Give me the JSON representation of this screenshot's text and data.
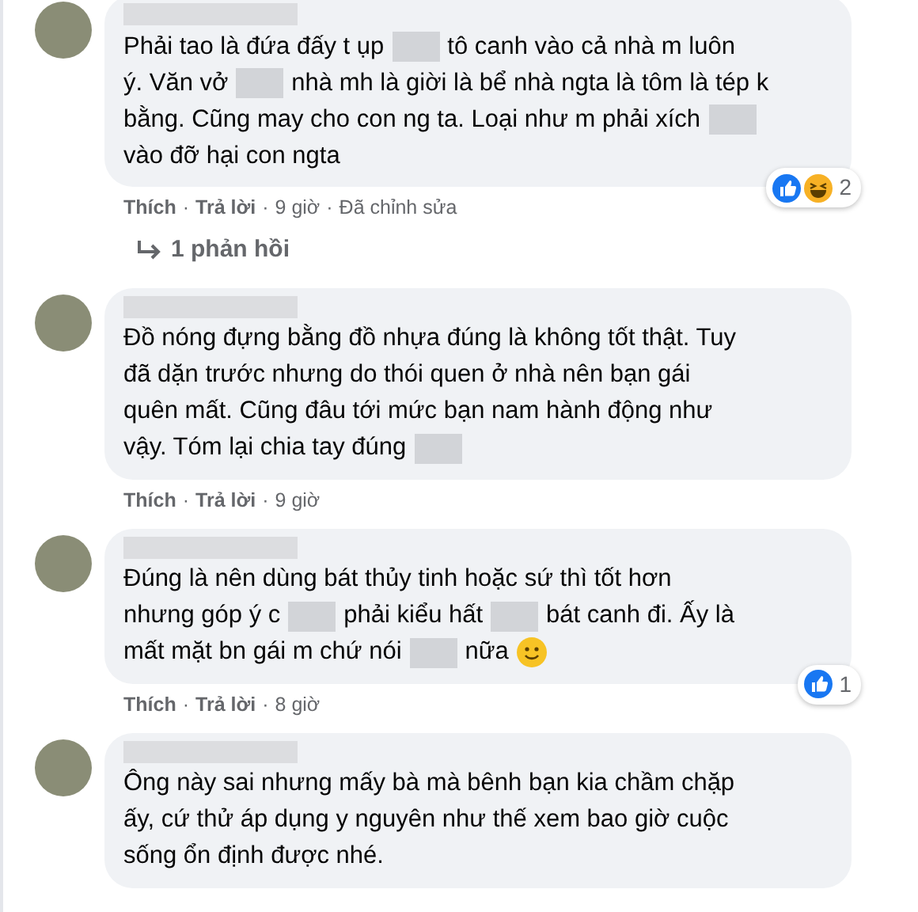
{
  "comments": [
    {
      "lines": [
        [
          {
            "kind": "text",
            "text": "Phải tao là đứa đấy t ụp"
          },
          {
            "kind": "blur"
          },
          {
            "kind": "text",
            "text": "tô canh vào cả nhà m luôn"
          }
        ],
        [
          {
            "kind": "text",
            "text": "ý. Văn vở"
          },
          {
            "kind": "blur"
          },
          {
            "kind": "text",
            "text": "nhà mh là giời là bể nhà ngta là tôm là tép k"
          }
        ],
        [
          {
            "kind": "text",
            "text": "bằng. Cũng may cho con ng ta. Loại như m phải xích"
          },
          {
            "kind": "blur"
          }
        ],
        [
          {
            "kind": "text",
            "text": "vào đỡ hại con ngta"
          }
        ]
      ],
      "actions": {
        "like": "Thích",
        "separator_1": "·",
        "reply": "Trả lời",
        "separator_2": "·",
        "time": "9 giờ",
        "separator_3": "·",
        "edited": "Đã chỉnh sửa"
      },
      "reactions": {
        "icons": [
          {
            "kind": "like"
          },
          {
            "kind": "haha"
          }
        ],
        "count": "2"
      },
      "replies": "1 phản hồi"
    },
    {
      "lines": [
        [
          {
            "kind": "text",
            "text": "Đồ nóng đựng bằng đồ nhựa đúng là không tốt thật. Tuy"
          }
        ],
        [
          {
            "kind": "text",
            "text": "đã dặn trước nhưng do thói quen ở nhà nên bạn gái"
          }
        ],
        [
          {
            "kind": "text",
            "text": "quên mất. Cũng đâu tới mức bạn nam hành động như"
          }
        ],
        [
          {
            "kind": "text",
            "text": "vậy. Tóm lại chia tay đúng"
          },
          {
            "kind": "blur"
          }
        ]
      ],
      "actions": {
        "like": "Thích",
        "separator_1": "·",
        "reply": "Trả lời",
        "separator_2": "·",
        "time": "9 giờ"
      }
    },
    {
      "lines": [
        [
          {
            "kind": "text",
            "text": "Đúng là nên dùng bát thủy tinh hoặc sứ thì tốt hơn"
          }
        ],
        [
          {
            "kind": "text",
            "text": "nhưng góp ý c"
          },
          {
            "kind": "blur"
          },
          {
            "kind": "text",
            "text": "phải kiểu hất"
          },
          {
            "kind": "blur"
          },
          {
            "kind": "text",
            "text": "bát canh đi. Ấy là"
          }
        ],
        [
          {
            "kind": "text",
            "text": "mất mặt bn gái m chứ nói"
          },
          {
            "kind": "blur"
          },
          {
            "kind": "text",
            "text": "nữa"
          },
          {
            "kind": "emoji"
          }
        ]
      ],
      "actions": {
        "like": "Thích",
        "separator_1": "·",
        "reply": "Trả lời",
        "separator_2": "·",
        "time": "8 giờ"
      },
      "reactions": {
        "icons": [
          {
            "kind": "like"
          }
        ],
        "count": "1"
      }
    },
    {
      "lines": [
        [
          {
            "kind": "text",
            "text": "Ông này sai nhưng mấy bà mà bênh bạn kia chầm chặp"
          }
        ],
        [
          {
            "kind": "text",
            "text": "ấy, cứ thử áp dụng y nguyên như thế xem bao giờ cuộc"
          }
        ],
        [
          {
            "kind": "text",
            "text": "sống ổn định được nhé."
          }
        ]
      ]
    }
  ]
}
